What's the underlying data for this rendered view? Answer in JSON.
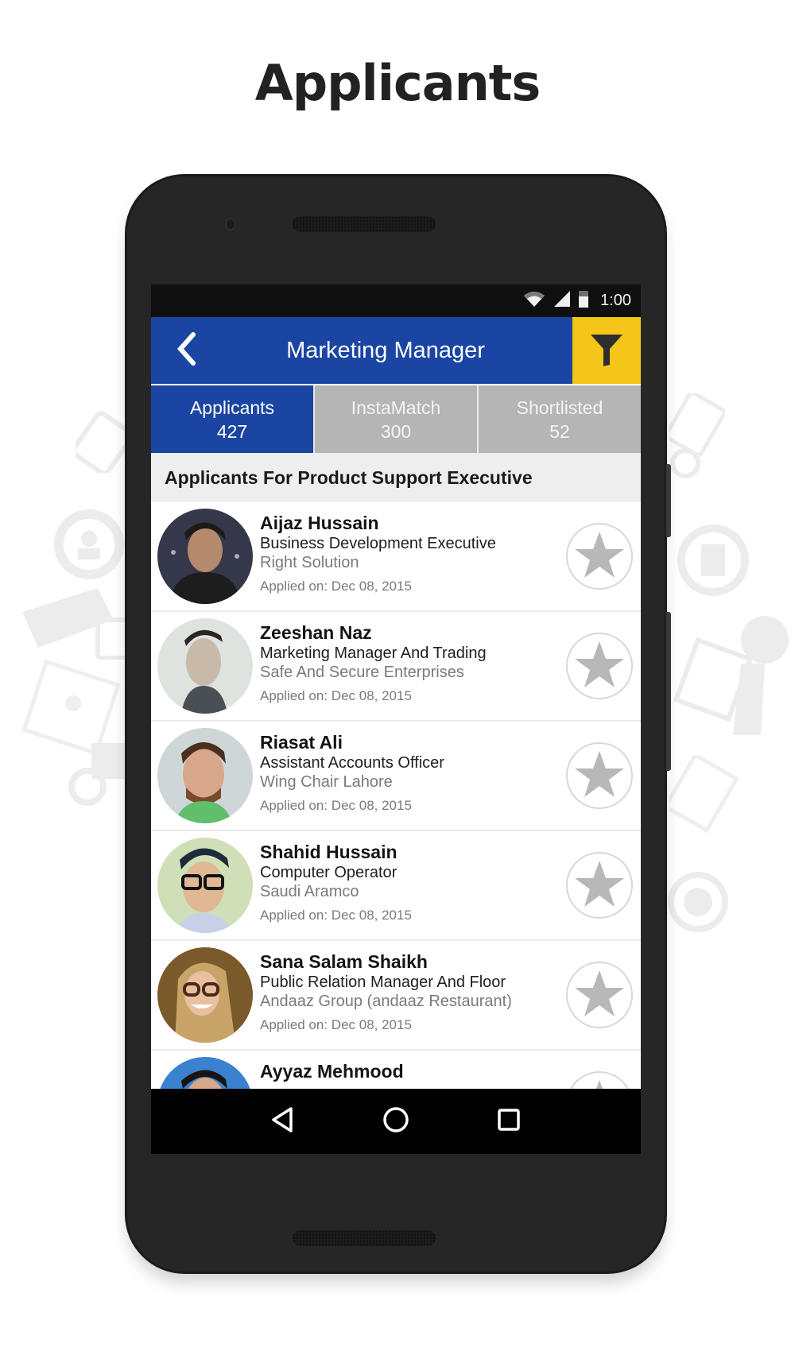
{
  "page_title": "Applicants",
  "status_bar": {
    "time": "1:00",
    "icons": [
      "wifi-icon",
      "signal-icon",
      "battery-icon"
    ]
  },
  "header": {
    "title": "Marketing Manager",
    "back_icon": "chevron-left-icon",
    "filter_icon": "filter-funnel-icon"
  },
  "colors": {
    "primary": "#1b45a3",
    "accent": "#f5c518",
    "tab_inactive": "#b5b5b5",
    "star": "#b8b8b8"
  },
  "tabs": [
    {
      "label": "Applicants",
      "count": "427",
      "active": true
    },
    {
      "label": "InstaMatch",
      "count": "300",
      "active": false
    },
    {
      "label": "Shortlisted",
      "count": "52",
      "active": false
    }
  ],
  "section_title": "Applicants For Product Support Executive",
  "applicants": [
    {
      "name": "Aijaz Hussain",
      "role": "Business Development Executive",
      "company": "Right Solution",
      "applied": "Applied on: Dec 08, 2015",
      "shortlisted": false
    },
    {
      "name": "Zeeshan Naz",
      "role": "Marketing Manager And Trading",
      "company": "Safe And Secure Enterprises",
      "applied": "Applied on: Dec 08, 2015",
      "shortlisted": false
    },
    {
      "name": "Riasat Ali",
      "role": "Assistant Accounts Officer",
      "company": "Wing Chair Lahore",
      "applied": "Applied on: Dec 08, 2015",
      "shortlisted": false
    },
    {
      "name": "Shahid Hussain",
      "role": "Computer Operator",
      "company": "Saudi Aramco",
      "applied": "Applied on: Dec 08, 2015",
      "shortlisted": false
    },
    {
      "name": "Sana Salam Shaikh",
      "role": "Public Relation Manager And Floor",
      "company": "Andaaz Group (andaaz Restaurant)",
      "applied": "Applied on: Dec 08, 2015",
      "shortlisted": false
    },
    {
      "name": "Ayyaz Mehmood",
      "role": "",
      "company": "",
      "applied": "",
      "shortlisted": false
    }
  ],
  "nav_bar": {
    "back": "nav-back-icon",
    "home": "nav-home-icon",
    "recents": "nav-recents-icon"
  }
}
